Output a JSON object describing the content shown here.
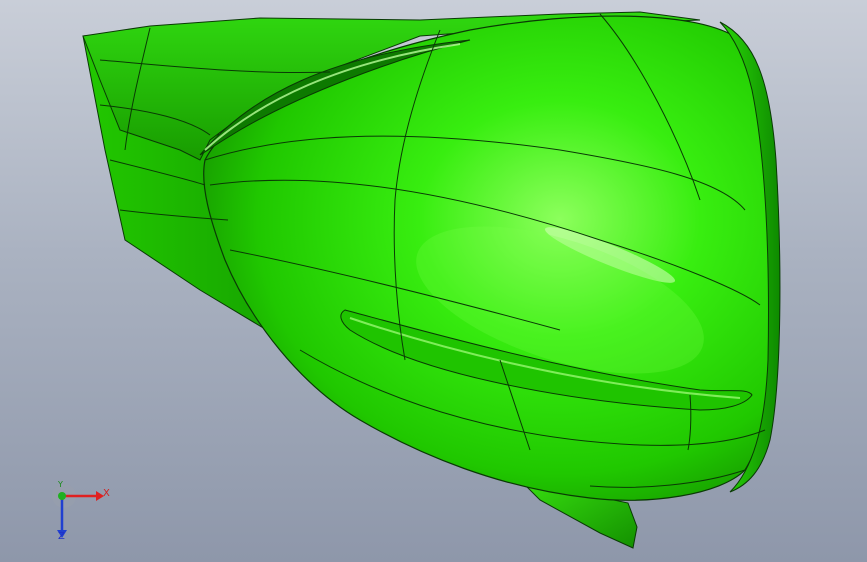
{
  "viewport": {
    "background_top": "#c9ced8",
    "background_bottom": "#8e97aa",
    "model": {
      "part": "green-body",
      "color": "#22e000",
      "highlight_color": "#9dff70",
      "shadow_color": "#0f8f00",
      "edge_color": "#0a3a05"
    },
    "triad": {
      "x_label": "X",
      "y_label": "Y",
      "z_label": "Z",
      "x_color": "#e02020",
      "y_color": "#20b020",
      "z_color": "#2040d0"
    }
  }
}
